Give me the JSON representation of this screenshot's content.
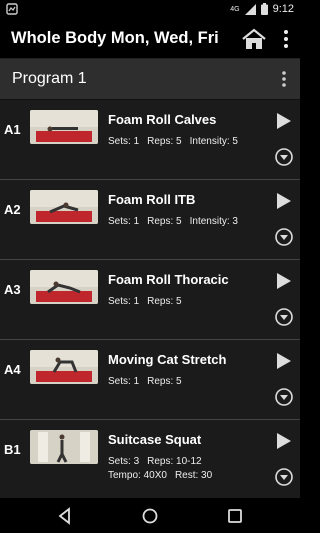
{
  "status_bar": {
    "time": "9:12",
    "network": "4G"
  },
  "app_bar": {
    "title": "Whole Body Mon, Wed, Fri"
  },
  "program": {
    "title": "Program 1"
  },
  "exercises": [
    {
      "code": "A1",
      "name": "Foam Roll Calves",
      "line1": [
        "Sets: 1",
        "Reps: 5",
        "Intensity: 5"
      ],
      "line2": []
    },
    {
      "code": "A2",
      "name": "Foam Roll ITB",
      "line1": [
        "Sets: 1",
        "Reps: 5",
        "Intensity: 3"
      ],
      "line2": []
    },
    {
      "code": "A3",
      "name": "Foam Roll Thoracic",
      "line1": [
        "Sets: 1",
        "Reps: 5"
      ],
      "line2": []
    },
    {
      "code": "A4",
      "name": "Moving Cat Stretch",
      "line1": [
        "Sets: 1",
        "Reps: 5"
      ],
      "line2": []
    },
    {
      "code": "B1",
      "name": "Suitcase Squat",
      "line1": [
        "Sets: 3",
        "Reps: 10-12"
      ],
      "line2": [
        "Tempo: 40X0",
        "Rest: 30"
      ]
    }
  ],
  "colors": {
    "background": "#000000",
    "row": "#1b1b1b",
    "program_bar": "#2e2e2e",
    "mat": "#c0272d"
  }
}
